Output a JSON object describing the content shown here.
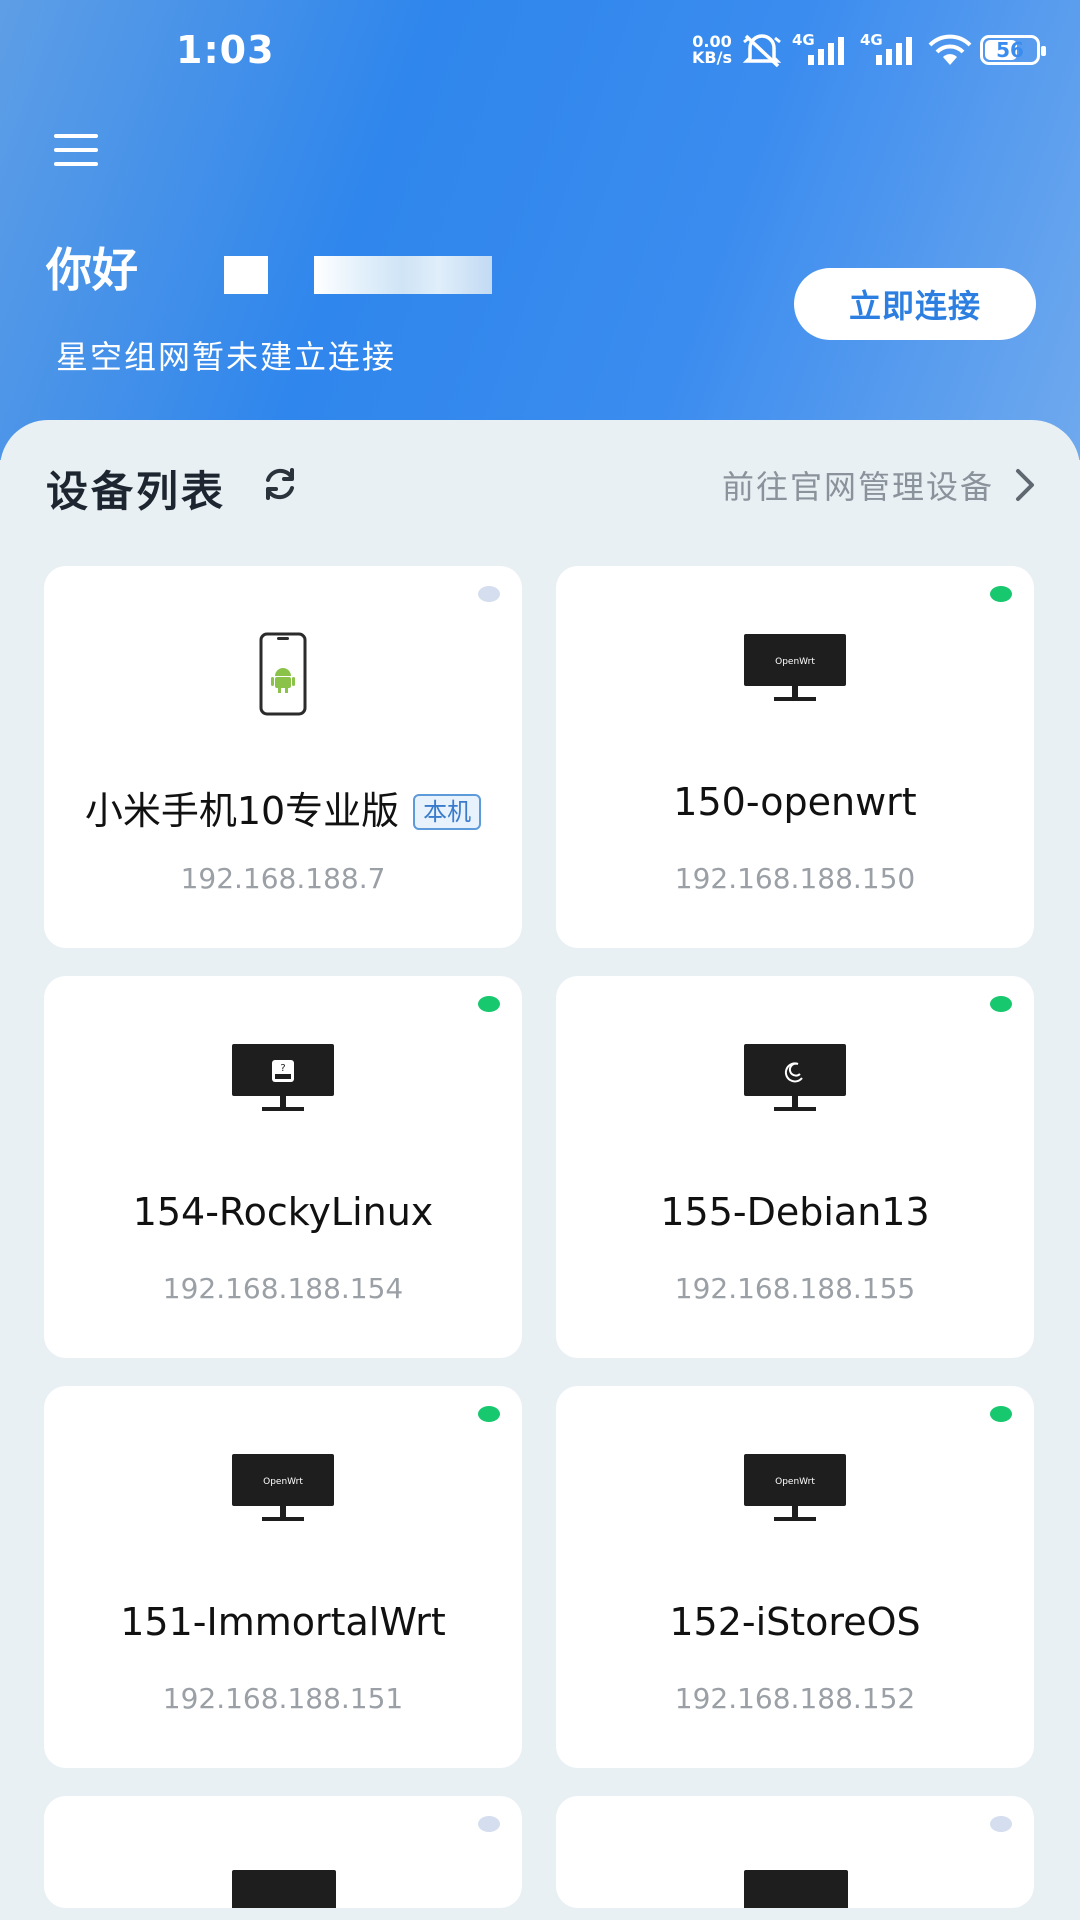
{
  "status_bar": {
    "time": "1:03",
    "net_speed_value": "0.00",
    "net_speed_unit": "KB/s",
    "signal1_label": "4G",
    "signal2_label": "4G",
    "battery": "56"
  },
  "header": {
    "greeting": "你好",
    "subtitle": "星空组网暂未建立连接",
    "connect_button": "立即连接"
  },
  "device_list": {
    "title": "设备列表",
    "manage_link": "前往官网管理设备",
    "devices": [
      {
        "name": "小米手机10专业版",
        "badge": "本机",
        "ip": "192.168.188.7",
        "status": "offline",
        "icon": "android-phone-icon"
      },
      {
        "name": "150-openwrt",
        "ip": "192.168.188.150",
        "status": "online",
        "icon": "openwrt-monitor-icon",
        "screen_text": "OpenWrt"
      },
      {
        "name": "154-RockyLinux",
        "ip": "192.168.188.154",
        "status": "online",
        "icon": "unknown-os-monitor-icon"
      },
      {
        "name": "155-Debian13",
        "ip": "192.168.188.155",
        "status": "online",
        "icon": "debian-monitor-icon"
      },
      {
        "name": "151-ImmortalWrt",
        "ip": "192.168.188.151",
        "status": "online",
        "icon": "openwrt-monitor-icon",
        "screen_text": "OpenWrt"
      },
      {
        "name": "152-iStoreOS",
        "ip": "192.168.188.152",
        "status": "online",
        "icon": "openwrt-monitor-icon",
        "screen_text": "OpenWrt"
      }
    ]
  },
  "colors": {
    "header_blue": "#2f86ec",
    "accent": "#2c7fe0",
    "online": "#17c86e",
    "offline": "#d4deef"
  }
}
